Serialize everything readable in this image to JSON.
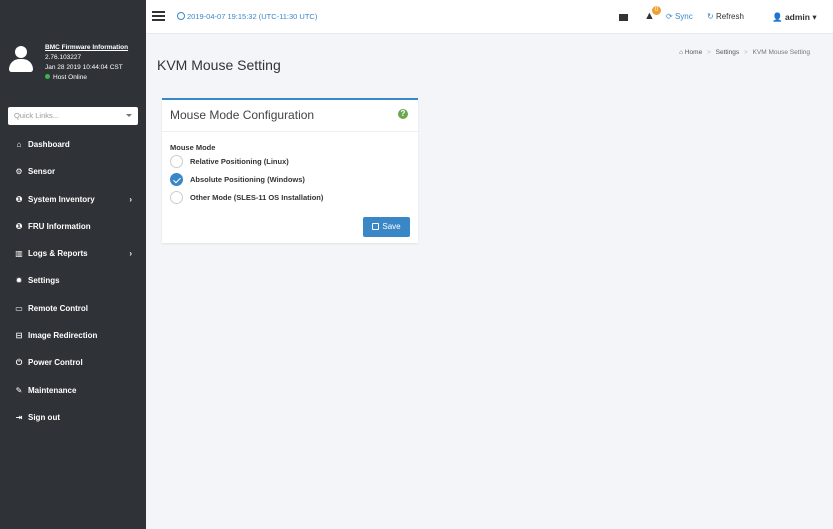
{
  "profile": {
    "title": "BMC Firmware Information",
    "version": "2.76.103227",
    "build_date": "Jan 28 2019 10:44:04 CST",
    "status": "Host Online"
  },
  "quick_links": {
    "placeholder": "Quick Links..."
  },
  "nav": {
    "items": [
      {
        "label": "Dashboard",
        "icon": "dashboard-icon",
        "glyph": "⌂",
        "chevron": ""
      },
      {
        "label": "Sensor",
        "icon": "sensor-icon",
        "glyph": "⚙",
        "chevron": ""
      },
      {
        "label": "System Inventory",
        "icon": "info-icon",
        "glyph": "❶",
        "chevron": "›"
      },
      {
        "label": "FRU Information",
        "icon": "info-icon",
        "glyph": "❶",
        "chevron": ""
      },
      {
        "label": "Logs & Reports",
        "icon": "chart-icon",
        "glyph": "▥",
        "chevron": "›"
      },
      {
        "label": "Settings",
        "icon": "gear-icon",
        "glyph": "✹",
        "chevron": ""
      },
      {
        "label": "Remote Control",
        "icon": "monitor-icon",
        "glyph": "▭",
        "chevron": ""
      },
      {
        "label": "Image Redirection",
        "icon": "disk-icon",
        "glyph": "⊟",
        "chevron": ""
      },
      {
        "label": "Power Control",
        "icon": "power-icon",
        "glyph": "⏻",
        "chevron": ""
      },
      {
        "label": "Maintenance",
        "icon": "wrench-icon",
        "glyph": "✎",
        "chevron": ""
      },
      {
        "label": "Sign out",
        "icon": "signout-icon",
        "glyph": "⇥",
        "chevron": ""
      }
    ]
  },
  "header": {
    "datetime": "2019-04-07 19:15:32 (UTC-11:30 UTC)",
    "notification_count": "0",
    "sync_label": "Sync",
    "refresh_label": "Refresh",
    "user_label": "admin"
  },
  "breadcrumb": {
    "home": "Home",
    "settings": "Settings",
    "current": "KVM Mouse Setting"
  },
  "page": {
    "title": "KVM Mouse Setting"
  },
  "panel": {
    "title": "Mouse Mode Configuration",
    "field_label": "Mouse Mode",
    "options": [
      {
        "label": "Relative Positioning (Linux)",
        "selected": false
      },
      {
        "label": "Absolute Positioning (Windows)",
        "selected": true
      },
      {
        "label": "Other Mode (SLES-11 OS Installation)",
        "selected": false
      }
    ],
    "save_label": "Save"
  },
  "colors": {
    "accent": "#3a87c8",
    "sidebar": "#2f3337",
    "online": "#39b54a",
    "badge": "#f0a030",
    "help": "#6aa84f"
  }
}
